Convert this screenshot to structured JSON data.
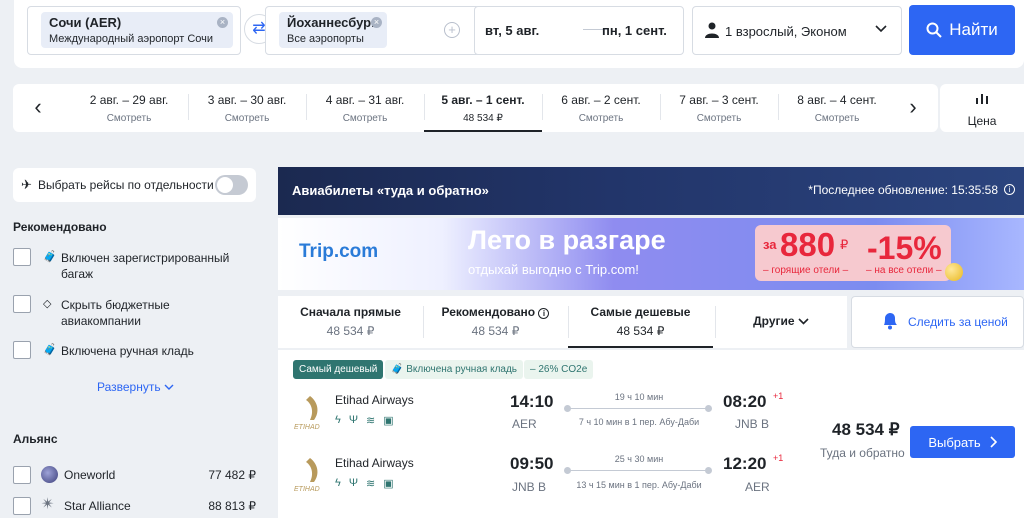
{
  "search": {
    "origin": {
      "code": "Сочи (AER)",
      "airport": "Международный аэропорт Сочи"
    },
    "destination": {
      "code": "Йоханнесбург",
      "airport": "Все аэропорты"
    },
    "depart_date": "вт, 5 авг.",
    "return_date": "пн, 1 сент.",
    "passengers": "1 взрослый, Эконом",
    "find_label": "Найти"
  },
  "date_strip": {
    "items": [
      {
        "dates": "2 авг. – 29 авг.",
        "sub": "Смотреть"
      },
      {
        "dates": "3 авг. – 30 авг.",
        "sub": "Смотреть"
      },
      {
        "dates": "4 авг. – 31 авг.",
        "sub": "Смотреть"
      },
      {
        "dates": "5 авг. – 1 сент.",
        "sub": "48 534 ₽"
      },
      {
        "dates": "6 авг. – 2 сент.",
        "sub": "Смотреть"
      },
      {
        "dates": "7 авг. – 3 сент.",
        "sub": "Смотреть"
      },
      {
        "dates": "8 авг. – 4 сент.",
        "sub": "Смотреть"
      }
    ],
    "active_index": 3,
    "price_tab_label": "Цена"
  },
  "sidebar": {
    "separate_toggle_label": "Выбрать рейсы по отдельности",
    "recommended_heading": "Рекомендовано",
    "filters": [
      {
        "label": "Включен зарегистрированный багаж"
      },
      {
        "label": "Скрыть бюджетные авиакомпании"
      },
      {
        "label": "Включена ручная кладь"
      }
    ],
    "expand_label": "Развернуть",
    "alliance_heading": "Альянс",
    "alliances": [
      {
        "label": "Oneworld",
        "price": "77 482 ₽"
      },
      {
        "label": "Star Alliance",
        "price": "88 813 ₽"
      }
    ]
  },
  "results_header": {
    "title": "Авиабилеты «туда и обратно»",
    "updated": "*Последнее обновление: 15:35:58"
  },
  "ad": {
    "brand": "Trip.com",
    "headline": "Лето в разгаре",
    "tagline": "отдыхай выгодно с Trip.com!",
    "za": "за",
    "price": "880",
    "currency": "₽",
    "discount": "-15%",
    "hotels": "– горящие отели –",
    "all_hotels": "– на все отели –"
  },
  "sort_tabs": [
    {
      "title": "Сначала прямые",
      "price": "48 534 ₽"
    },
    {
      "title": "Рекомендовано",
      "price": "48 534 ₽"
    },
    {
      "title": "Самые дешевые",
      "price": "48 534 ₽"
    },
    {
      "title": "Другие",
      "price": ""
    }
  ],
  "follow_price_label": "Следить за ценой",
  "offer": {
    "badges": [
      "Самый дешевый",
      "Включена ручная кладь",
      "– 26% CO2e"
    ],
    "legs": [
      {
        "airline": "Etihad Airways",
        "dep_time": "14:10",
        "dep_airport": "AER",
        "duration": "19 ч 10 мин",
        "route": "7 ч 10 мин в 1 пер. Абу-Даби",
        "arr_time": "08:20",
        "plus": "+1",
        "arr_airport": "JNB B"
      },
      {
        "airline": "Etihad Airways",
        "dep_time": "09:50",
        "dep_airport": "JNB B",
        "duration": "25 ч 30 мин",
        "route": "13 ч 15 мин в 1 пер. Абу-Даби",
        "arr_time": "12:20",
        "plus": "+1",
        "arr_airport": "AER"
      }
    ],
    "price": "48 534 ₽",
    "price_note": "Туда и обратно",
    "choose_label": "Выбрать"
  },
  "colors": {
    "accent": "#2d66f3",
    "badge_green": "#2f7570",
    "promo_red": "#e8273c"
  }
}
